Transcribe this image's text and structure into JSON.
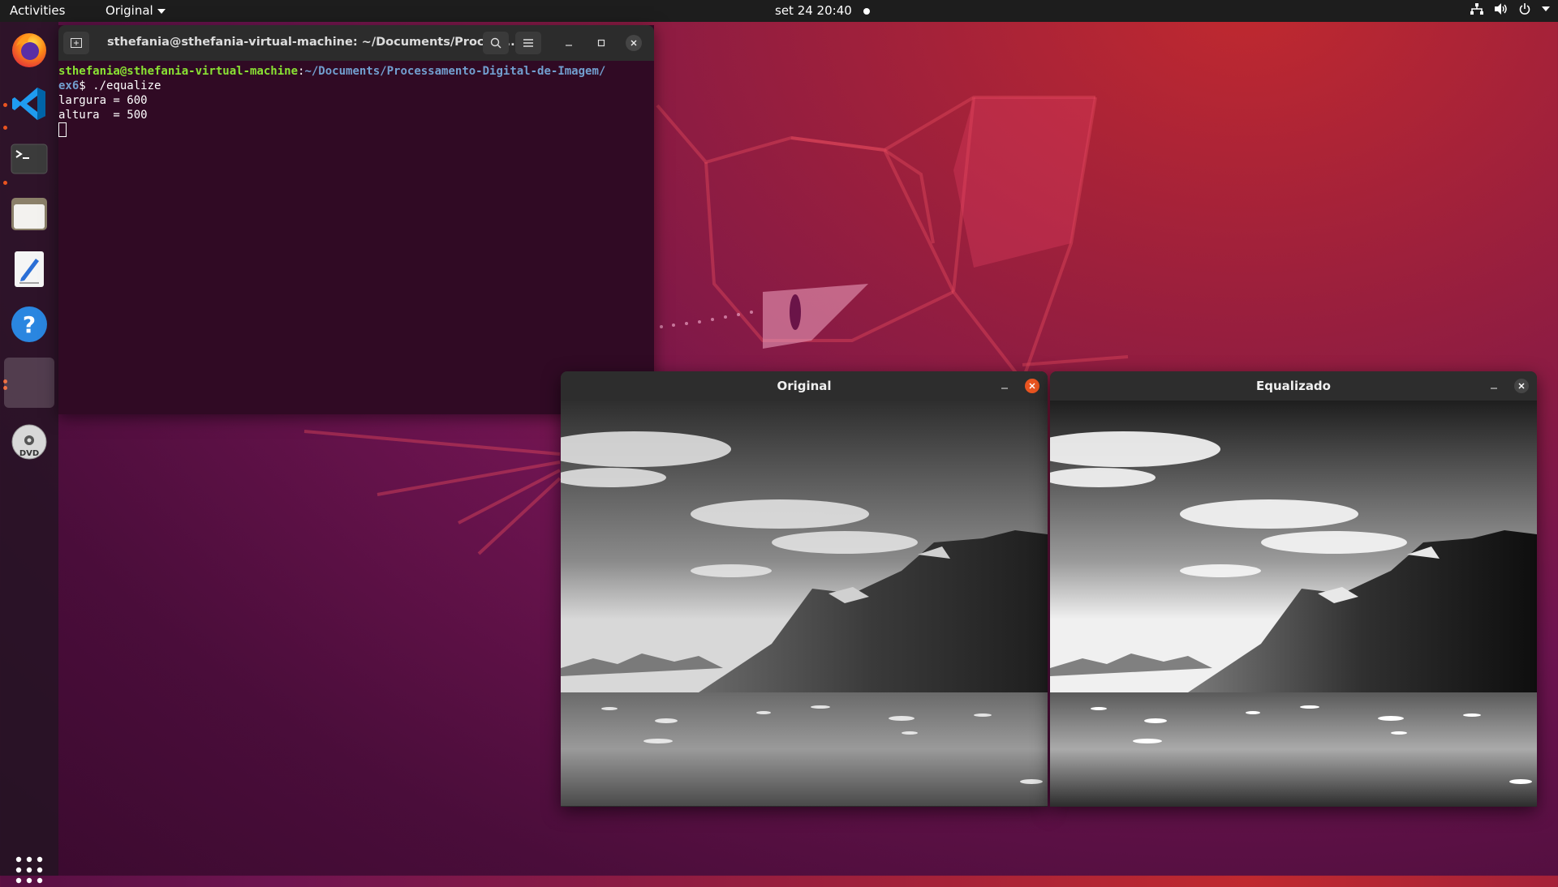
{
  "topbar": {
    "activities": "Activities",
    "app_menu": "Original",
    "clock": "set 24  20:40"
  },
  "dock": {
    "items": [
      {
        "name": "firefox",
        "icon": "firefox-icon"
      },
      {
        "name": "vscode",
        "icon": "vscode-icon"
      },
      {
        "name": "terminal",
        "icon": "terminal-icon"
      },
      {
        "name": "files",
        "icon": "files-icon"
      },
      {
        "name": "text-editor",
        "icon": "text-editor-icon"
      },
      {
        "name": "help",
        "icon": "help-icon"
      },
      {
        "name": "running-app",
        "icon": "blank-app-icon"
      },
      {
        "name": "dvd",
        "icon": "dvd-icon",
        "label": "DVD"
      }
    ],
    "show_apps_icon": "app-grid-icon"
  },
  "terminal": {
    "title": "sthefania@sthefania-virtual-machine: ~/Documents/Process...",
    "prompt_user": "sthefania@sthefania-virtual-machine",
    "prompt_sep": ":",
    "prompt_path_1": "~/Documents/Processamento-Digital-de-Imagem/",
    "prompt_path_2": "ex6",
    "prompt_symbol": "$ ",
    "command": "./equalize",
    "output_1": "largura = 600",
    "output_2": "altura  = 500"
  },
  "windows": {
    "original": {
      "title": "Original"
    },
    "equalized": {
      "title": "Equalizado"
    }
  },
  "colors": {
    "accent_close": "#e95420",
    "terminal_bg": "#300a24",
    "prompt_user": "#8ae234",
    "prompt_path": "#729fcf"
  }
}
